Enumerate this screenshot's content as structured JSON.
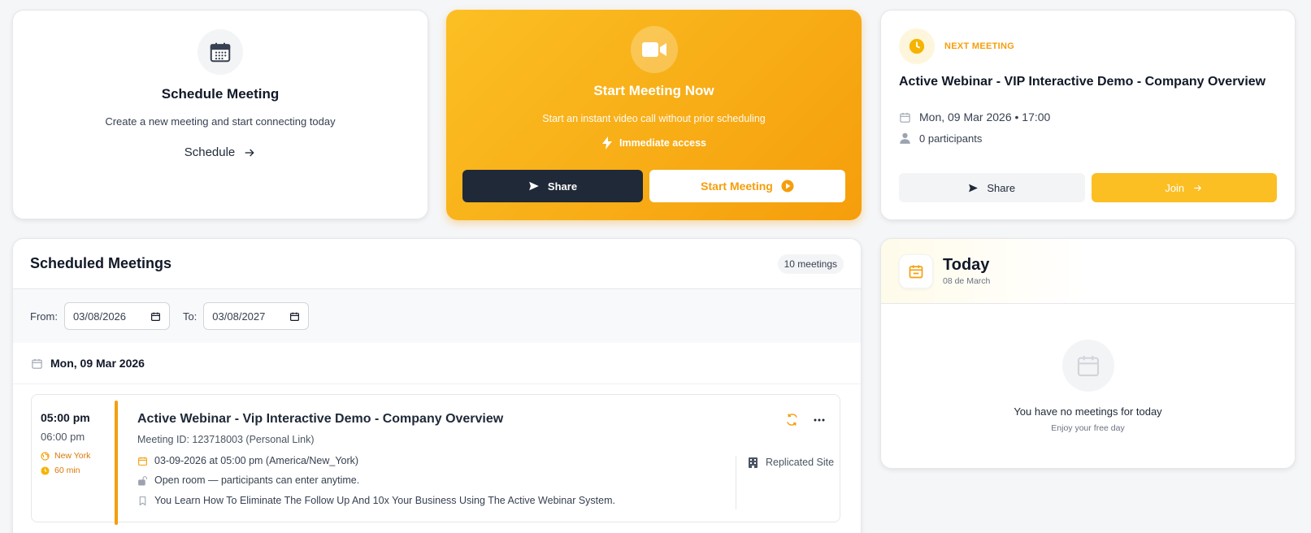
{
  "schedule": {
    "title": "Schedule Meeting",
    "description": "Create a new meeting and start connecting today",
    "link_label": "Schedule"
  },
  "start_now": {
    "title": "Start Meeting Now",
    "description": "Start an instant video call without prior scheduling",
    "immediate_label": "Immediate access",
    "share_label": "Share",
    "start_label": "Start Meeting"
  },
  "next_meeting": {
    "label": "NEXT MEETING",
    "title": "Active Webinar - VIP Interactive Demo - Company Overview",
    "datetime": "Mon, 09 Mar 2026 • 17:00",
    "participants": "0 participants",
    "share_label": "Share",
    "join_label": "Join"
  },
  "scheduled": {
    "title": "Scheduled Meetings",
    "count_badge": "10 meetings",
    "from_label": "From:",
    "from_value": "03/08/2026",
    "to_label": "To:",
    "to_value": "03/08/2027",
    "day_heading": "Mon, 09 Mar 2026",
    "items": [
      {
        "start_time": "05:00 pm",
        "end_time": "06:00 pm",
        "location": "New York",
        "duration": "60 min",
        "title": "Active Webinar - Vip Interactive Demo - Company Overview",
        "meeting_id": "Meeting ID: 123718003 (Personal Link)",
        "schedule_text": "03-09-2026 at 05:00 pm (America/New_York)",
        "access_text": "Open room — participants can enter anytime.",
        "description": "You Learn How To Eliminate The Follow Up And 10x Your Business Using The Active Webinar System.",
        "site": "Replicated Site"
      }
    ]
  },
  "today": {
    "title": "Today",
    "date": "08 de March",
    "empty_title": "You have no meetings for today",
    "empty_sub": "Enjoy your free day"
  },
  "colors": {
    "accent": "#f59e0b",
    "accent_light": "#fbbf24",
    "dark": "#1f2937"
  }
}
